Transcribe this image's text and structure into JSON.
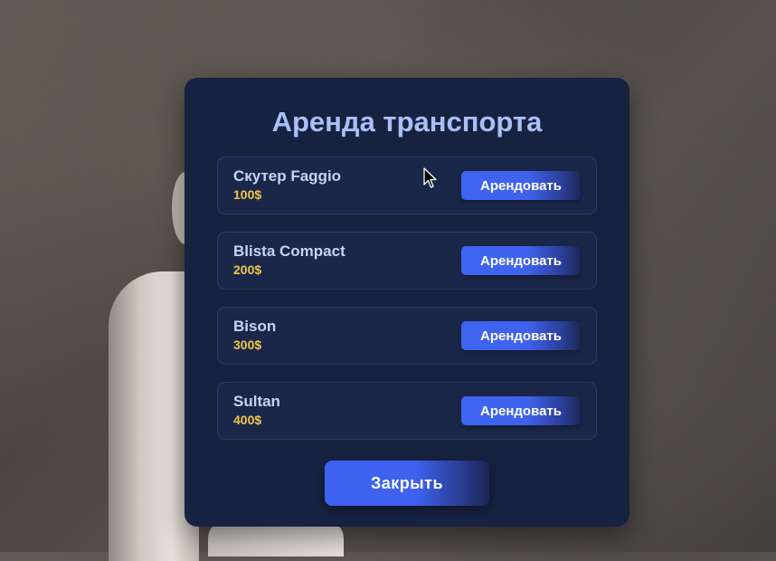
{
  "dialog": {
    "title": "Аренда транспорта",
    "close_label": "Закрыть"
  },
  "vehicles": [
    {
      "name": "Скутер Faggio",
      "price": "100$",
      "button_label": "Арендовать"
    },
    {
      "name": "Blista Compact",
      "price": "200$",
      "button_label": "Арендовать"
    },
    {
      "name": "Bison",
      "price": "300$",
      "button_label": "Арендовать"
    },
    {
      "name": "Sultan",
      "price": "400$",
      "button_label": "Арендовать"
    }
  ],
  "colors": {
    "panel_background": "#172241",
    "card_background": "#1b2749",
    "title_text": "#a9c0f5",
    "price_text": "#f0c74a",
    "button_accent": "#3f62ee"
  },
  "icons": {
    "cursor": "mouse-pointer-icon"
  }
}
